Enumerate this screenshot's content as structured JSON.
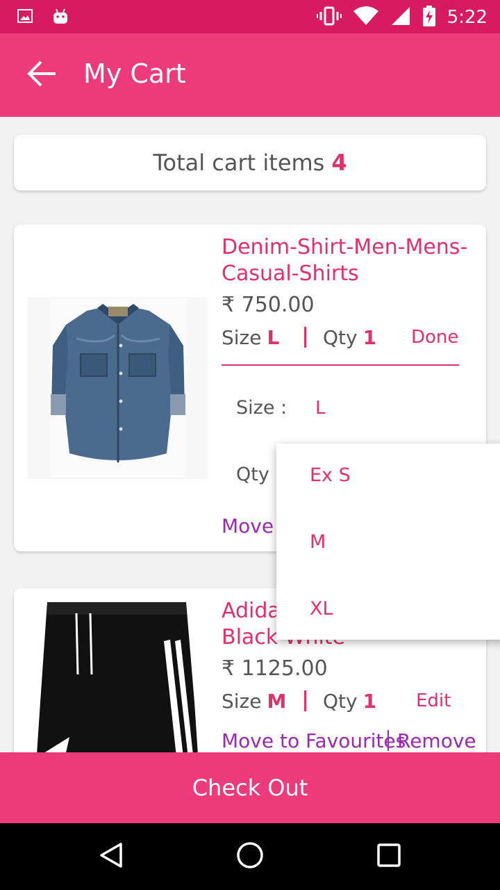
{
  "status_bar": {
    "time": "5:22",
    "icons": [
      "image-icon",
      "android-icon",
      "vibrate-icon",
      "wifi-icon",
      "signal-icon",
      "battery-charging-icon"
    ]
  },
  "app_bar": {
    "title": "My Cart",
    "back_icon": "arrow-back-icon"
  },
  "summary": {
    "label": "Total cart items",
    "count": "4"
  },
  "items": [
    {
      "name": "Denim-Shirt-Men-Mens-Casual-Shirts",
      "name_line1": "Denim-Shirt-Men-Mens-",
      "name_line2": "Casual-Shirts",
      "price": "₹ 750.00",
      "size_label": "Size",
      "size_value": "L",
      "qty_label": "Qty",
      "qty_value": "1",
      "action": "Done",
      "edit_size_label": "Size :",
      "edit_size_value": "L",
      "edit_qty_label": "Qty :",
      "move_text": "Move t"
    },
    {
      "name_line1": "Adida",
      "name_line2": "Black-White",
      "price": "₹ 1125.00",
      "size_label": "Size",
      "size_value": "M",
      "qty_label": "Qty",
      "qty_value": "1",
      "action": "Edit",
      "move_text": "Move to Favourites",
      "remove_text": "Remove"
    }
  ],
  "size_dropdown": {
    "options": [
      "Ex S",
      "M",
      "XL"
    ]
  },
  "checkout": {
    "label": "Check Out"
  },
  "nav_bar": {
    "icons": [
      "back-triangle-icon",
      "home-circle-icon",
      "recents-square-icon"
    ]
  },
  "colors": {
    "primary": "#ec3a7a",
    "primary_dark": "#d81b60",
    "accent_text": "#e0306f",
    "link_purple": "#9c27b0"
  }
}
